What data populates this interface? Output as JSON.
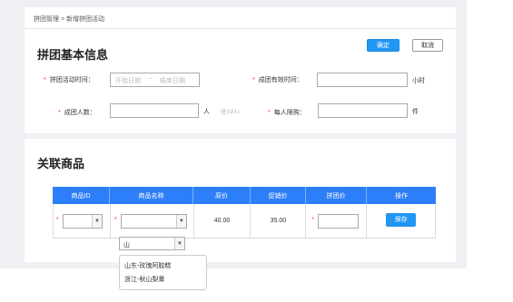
{
  "breadcrumb": "拼团管理 > 新增拼团活动",
  "basic": {
    "title": "拼团基本信息",
    "confirm": "确定",
    "cancel": "取消",
    "activity_time_label": "拼团活动时间：",
    "start_placeholder": "开始日期",
    "date_sep": "~",
    "end_placeholder": "结束日期",
    "valid_time_label": "成团有效时间：",
    "valid_time_unit": "小时",
    "group_size_label": "成团人数：",
    "group_size_unit": "人",
    "group_size_hint": "（至少2人）",
    "limit_label": "每人限购：",
    "limit_unit": "件",
    "required_mark": "*"
  },
  "related": {
    "title": "关联商品",
    "columns": [
      "商品ID",
      "商品名称",
      "原价",
      "促销价",
      "拼团价",
      "操作"
    ],
    "row": {
      "original_price": "40.00",
      "promo_price": "35.00",
      "save": "保存"
    },
    "search_text": "山",
    "options": [
      "山东-玫瑰阿胶糕",
      "浙江-秋山梨膏"
    ]
  }
}
